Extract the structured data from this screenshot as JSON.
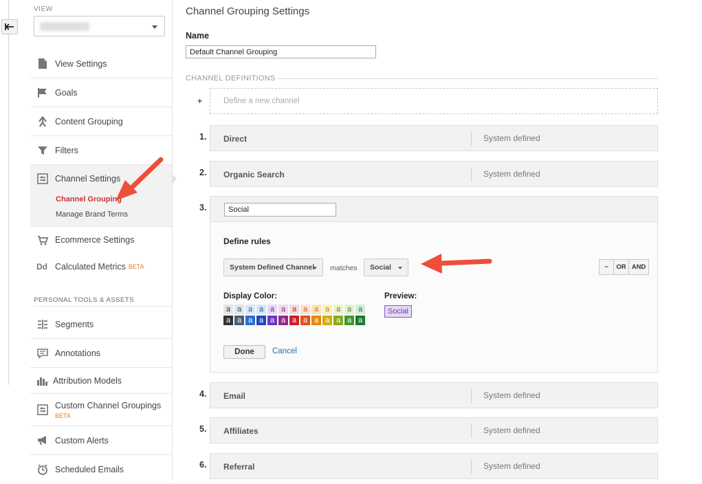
{
  "sidebar": {
    "view_label": "VIEW",
    "items": [
      {
        "label": "View Settings",
        "icon": "document-icon"
      },
      {
        "label": "Goals",
        "icon": "flag-icon"
      },
      {
        "label": "Content Grouping",
        "icon": "person-walk-icon"
      },
      {
        "label": "Filters",
        "icon": "funnel-icon"
      },
      {
        "label": "Channel Settings",
        "icon": "channel-settings-icon"
      },
      {
        "label": "Ecommerce Settings",
        "icon": "cart-icon"
      },
      {
        "label": "Calculated Metrics",
        "icon": "dd-icon",
        "badge": "BETA"
      },
      {
        "label": "Segments",
        "icon": "segments-icon"
      },
      {
        "label": "Annotations",
        "icon": "annotation-icon"
      },
      {
        "label": "Attribution Models",
        "icon": "bar-chart-icon"
      },
      {
        "label": "Custom Channel Groupings",
        "icon": "custom-channel-icon",
        "badge": "BETA"
      },
      {
        "label": "Custom Alerts",
        "icon": "megaphone-icon"
      },
      {
        "label": "Scheduled Emails",
        "icon": "clock-icon"
      }
    ],
    "sub_items": [
      {
        "label": "Channel Grouping",
        "active": true
      },
      {
        "label": "Manage Brand Terms",
        "active": false
      }
    ],
    "section_personal": "PERSONAL TOOLS & ASSETS"
  },
  "main": {
    "title": "Channel Grouping Settings",
    "name_label": "Name",
    "name_value": "Default Channel Grouping",
    "definitions_label": "CHANNEL DEFINITIONS",
    "plus": "+",
    "define_new": "Define a new channel",
    "channels": [
      {
        "num": "1.",
        "name": "Direct",
        "status": "System defined"
      },
      {
        "num": "2.",
        "name": "Organic Search",
        "status": "System defined"
      },
      {
        "num": "3.",
        "name": "Social",
        "status": ""
      },
      {
        "num": "4.",
        "name": "Email",
        "status": "System defined"
      },
      {
        "num": "5.",
        "name": "Affiliates",
        "status": "System defined"
      },
      {
        "num": "6.",
        "name": "Referral",
        "status": "System defined"
      }
    ],
    "editor": {
      "define_rules": "Define rules",
      "dimension": "System Defined Channel",
      "matches": "matches",
      "value": "Social",
      "minus": "−",
      "or": "OR",
      "and": "AND",
      "display_color": "Display Color:",
      "preview_label": "Preview:",
      "preview_text": "Social",
      "swatch_letter": "a",
      "swatches_row1": [
        {
          "bg": "#e4e4e4",
          "fg": "#333333"
        },
        {
          "bg": "#dfe3ea",
          "fg": "#3a4a66"
        },
        {
          "bg": "#dbe6f7",
          "fg": "#2a5fb0"
        },
        {
          "bg": "#d6e4f8",
          "fg": "#1d4ea6"
        },
        {
          "bg": "#e6d9f6",
          "fg": "#5a2fa0"
        },
        {
          "bg": "#eed9ea",
          "fg": "#8a2a7a"
        },
        {
          "bg": "#f7d9dc",
          "fg": "#c0262b"
        },
        {
          "bg": "#fae1d3",
          "fg": "#d0521c"
        },
        {
          "bg": "#fbe3b8",
          "fg": "#c77a0f"
        },
        {
          "bg": "#fbf0bd",
          "fg": "#a9870d"
        },
        {
          "bg": "#eef2c8",
          "fg": "#6a8a12"
        },
        {
          "bg": "#e2f0d4",
          "fg": "#3f8a1c"
        },
        {
          "bg": "#d6ecd6",
          "fg": "#1d7a2e"
        }
      ],
      "swatches_row2": [
        {
          "bg": "#333333",
          "fg": "#ffffff"
        },
        {
          "bg": "#4d5d7a",
          "fg": "#ffffff"
        },
        {
          "bg": "#2e6ed6",
          "fg": "#ffffff"
        },
        {
          "bg": "#1f49b8",
          "fg": "#ffffff"
        },
        {
          "bg": "#6a38c4",
          "fg": "#ffffff"
        },
        {
          "bg": "#8e2c86",
          "fg": "#ffffff"
        },
        {
          "bg": "#cc1f27",
          "fg": "#ffffff"
        },
        {
          "bg": "#e0521b",
          "fg": "#ffffff"
        },
        {
          "bg": "#e08a12",
          "fg": "#ffffff"
        },
        {
          "bg": "#d8ad0e",
          "fg": "#ffffff"
        },
        {
          "bg": "#8aab1c",
          "fg": "#ffffff"
        },
        {
          "bg": "#3f9a2a",
          "fg": "#ffffff"
        },
        {
          "bg": "#1a7a34",
          "fg": "#ffffff"
        }
      ],
      "done": "Done",
      "cancel": "Cancel"
    }
  },
  "colors": {
    "accent_red": "#cc3333",
    "link_blue": "#1a6fb3",
    "arrow": "#ee4e3a",
    "beta": "#e67e22"
  }
}
